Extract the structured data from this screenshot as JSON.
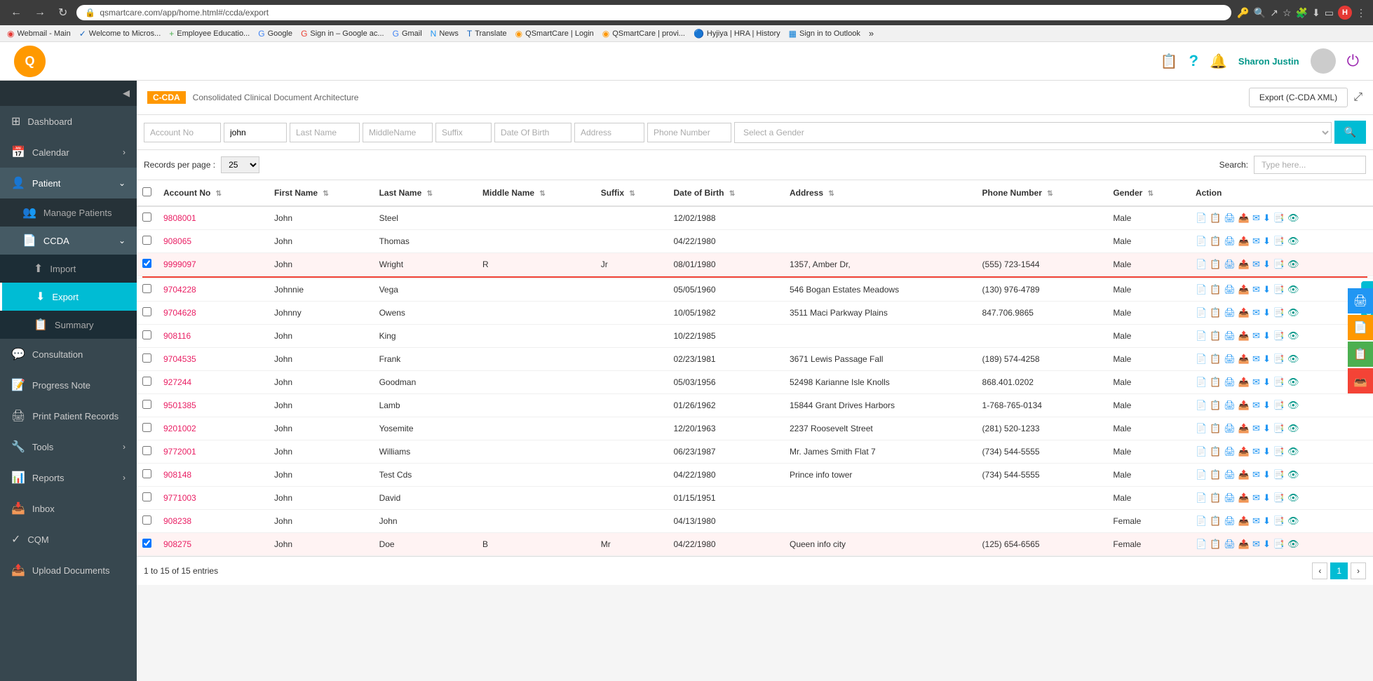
{
  "browser": {
    "url": "qsmartcare.com/app/home.html#/ccda/export",
    "back": "←",
    "forward": "→",
    "reload": "↻",
    "bookmarks": [
      {
        "label": "Webmail - Main",
        "color": "#e53935"
      },
      {
        "label": "Welcome to Micros...",
        "color": "#1565c0"
      },
      {
        "label": "Employee Educatio...",
        "color": "#4caf50"
      },
      {
        "label": "Google",
        "color": "#4285f4"
      },
      {
        "label": "Sign in – Google ac...",
        "color": "#ea4335"
      },
      {
        "label": "Gmail",
        "color": "#4285f4"
      },
      {
        "label": "News",
        "color": "#2196f3"
      },
      {
        "label": "Translate",
        "color": "#1565c0"
      },
      {
        "label": "QSmartCare | Login",
        "color": "#ff9800"
      },
      {
        "label": "QSmartCare | provi...",
        "color": "#ff9800"
      },
      {
        "label": "Hyjiya | HRA | History",
        "color": "#2196f3"
      },
      {
        "label": "Sign in to Outlook",
        "color": "#0078d4"
      }
    ]
  },
  "header": {
    "logo_text": "Q",
    "user": "Sharon Justin",
    "icons": [
      "📋",
      "?",
      "🔔"
    ]
  },
  "sidebar": {
    "items": [
      {
        "label": "Dashboard",
        "icon": "⊞",
        "active": false
      },
      {
        "label": "Calendar",
        "icon": "📅",
        "active": false,
        "has_arrow": true
      },
      {
        "label": "Patient",
        "icon": "👤",
        "active": true,
        "has_arrow": true,
        "expanded": true
      },
      {
        "label": "Manage Patients",
        "icon": "👥",
        "is_sub": true,
        "active": false
      },
      {
        "label": "CCDA",
        "icon": "📄",
        "is_sub": true,
        "active": true,
        "expanded": true,
        "has_arrow": true
      },
      {
        "label": "Import",
        "icon": "⬆",
        "is_sub2": true,
        "active": false
      },
      {
        "label": "Export",
        "icon": "⬇",
        "is_sub2": true,
        "active": true
      },
      {
        "label": "Summary",
        "icon": "📋",
        "is_sub2": true,
        "active": false
      },
      {
        "label": "Consultation",
        "icon": "💬",
        "active": false
      },
      {
        "label": "Progress Note",
        "icon": "📝",
        "active": false
      },
      {
        "label": "Print Patient Records",
        "icon": "🖨",
        "active": false
      },
      {
        "label": "Tools",
        "icon": "🔧",
        "active": false,
        "has_arrow": true
      },
      {
        "label": "Reports",
        "icon": "📊",
        "active": false,
        "has_arrow": true
      },
      {
        "label": "Inbox",
        "icon": "📥",
        "active": false
      },
      {
        "label": "CQM",
        "icon": "✓",
        "active": false
      },
      {
        "label": "Upload Documents",
        "icon": "📤",
        "active": false
      }
    ]
  },
  "ccda": {
    "badge": "C-CDA",
    "title": "Consolidated Clinical Document Architecture",
    "export_btn": "Export (C-CDA XML)",
    "expand_icon": "⤢"
  },
  "filters": {
    "account_no_placeholder": "Account No",
    "first_name_value": "john",
    "last_name_placeholder": "Last Name",
    "middle_name_placeholder": "MiddleName",
    "suffix_placeholder": "Suffix",
    "dob_placeholder": "Date Of Birth",
    "address_placeholder": "Address",
    "phone_placeholder": "Phone Number",
    "gender_placeholder": "Select a Gender",
    "search_icon": "🔍"
  },
  "table": {
    "records_per_page_label": "Records per page :",
    "records_per_page_value": "25",
    "search_label": "Search:",
    "search_placeholder": "Type here...",
    "columns": [
      "Account No",
      "First Name",
      "Last Name",
      "Middle Name",
      "Suffix",
      "Date of Birth",
      "Address",
      "Phone Number",
      "Gender",
      "Action"
    ],
    "rows": [
      {
        "account_no": "9808001",
        "first": "John",
        "last": "Steel",
        "middle": "",
        "suffix": "",
        "dob": "12/02/1988",
        "address": "",
        "phone": "",
        "gender": "Male",
        "checked": false
      },
      {
        "account_no": "908065",
        "first": "John",
        "last": "Thomas",
        "middle": "",
        "suffix": "",
        "dob": "04/22/1980",
        "address": "",
        "phone": "",
        "gender": "Male",
        "checked": false
      },
      {
        "account_no": "9999097",
        "first": "John",
        "last": "Wright",
        "middle": "R",
        "suffix": "Jr",
        "dob": "08/01/1980",
        "address": "1357, Amber Dr,",
        "phone": "(555) 723-1544",
        "gender": "Male",
        "checked": true
      },
      {
        "account_no": "9704228",
        "first": "Johnnie",
        "last": "Vega",
        "middle": "",
        "suffix": "",
        "dob": "05/05/1960",
        "address": "546 Bogan Estates Meadows",
        "phone": "(130) 976-4789",
        "gender": "Male",
        "checked": false
      },
      {
        "account_no": "9704628",
        "first": "Johnny",
        "last": "Owens",
        "middle": "",
        "suffix": "",
        "dob": "10/05/1982",
        "address": "3511 Maci Parkway Plains",
        "phone": "847.706.9865",
        "gender": "Male",
        "checked": false
      },
      {
        "account_no": "908116",
        "first": "John",
        "last": "King",
        "middle": "",
        "suffix": "",
        "dob": "10/22/1985",
        "address": "",
        "phone": "",
        "gender": "Male",
        "checked": false
      },
      {
        "account_no": "9704535",
        "first": "John",
        "last": "Frank",
        "middle": "",
        "suffix": "",
        "dob": "02/23/1981",
        "address": "3671 Lewis Passage Fall",
        "phone": "(189) 574-4258",
        "gender": "Male",
        "checked": false
      },
      {
        "account_no": "927244",
        "first": "John",
        "last": "Goodman",
        "middle": "",
        "suffix": "",
        "dob": "05/03/1956",
        "address": "52498 Karianne Isle Knolls",
        "phone": "868.401.0202",
        "gender": "Male",
        "checked": false
      },
      {
        "account_no": "9501385",
        "first": "John",
        "last": "Lamb",
        "middle": "",
        "suffix": "",
        "dob": "01/26/1962",
        "address": "15844 Grant Drives Harbors",
        "phone": "1-768-765-0134",
        "gender": "Male",
        "checked": false
      },
      {
        "account_no": "9201002",
        "first": "John",
        "last": "Yosemite",
        "middle": "",
        "suffix": "",
        "dob": "12/20/1963",
        "address": "2237 Roosevelt Street",
        "phone": "(281) 520-1233",
        "gender": "Male",
        "checked": false
      },
      {
        "account_no": "9772001",
        "first": "John",
        "last": "Williams",
        "middle": "",
        "suffix": "",
        "dob": "06/23/1987",
        "address": "Mr. James Smith Flat 7",
        "phone": "(734) 544-5555",
        "gender": "Male",
        "checked": false
      },
      {
        "account_no": "908148",
        "first": "John",
        "last": "Test Cds",
        "middle": "",
        "suffix": "",
        "dob": "04/22/1980",
        "address": "Prince info tower",
        "phone": "(734) 544-5555",
        "gender": "Male",
        "checked": false
      },
      {
        "account_no": "9771003",
        "first": "John",
        "last": "David",
        "middle": "",
        "suffix": "",
        "dob": "01/15/1951",
        "address": "",
        "phone": "",
        "gender": "Male",
        "checked": false
      },
      {
        "account_no": "908238",
        "first": "John",
        "last": "John",
        "middle": "",
        "suffix": "",
        "dob": "04/13/1980",
        "address": "",
        "phone": "",
        "gender": "Female",
        "checked": false
      },
      {
        "account_no": "908275",
        "first": "John",
        "last": "Doe",
        "middle": "B",
        "suffix": "Mr",
        "dob": "04/22/1980",
        "address": "Queen info city",
        "phone": "(125) 654-6565",
        "gender": "Female",
        "checked": true
      }
    ],
    "entries_info": "1 to 15 of 15 entries",
    "current_page": "1"
  },
  "floating_btns": [
    {
      "icon": "🖨",
      "color": "blue"
    },
    {
      "icon": "📄",
      "color": "orange"
    },
    {
      "icon": "📋",
      "color": "green"
    },
    {
      "icon": "📥",
      "color": "red"
    }
  ],
  "feedback": "Feedback"
}
